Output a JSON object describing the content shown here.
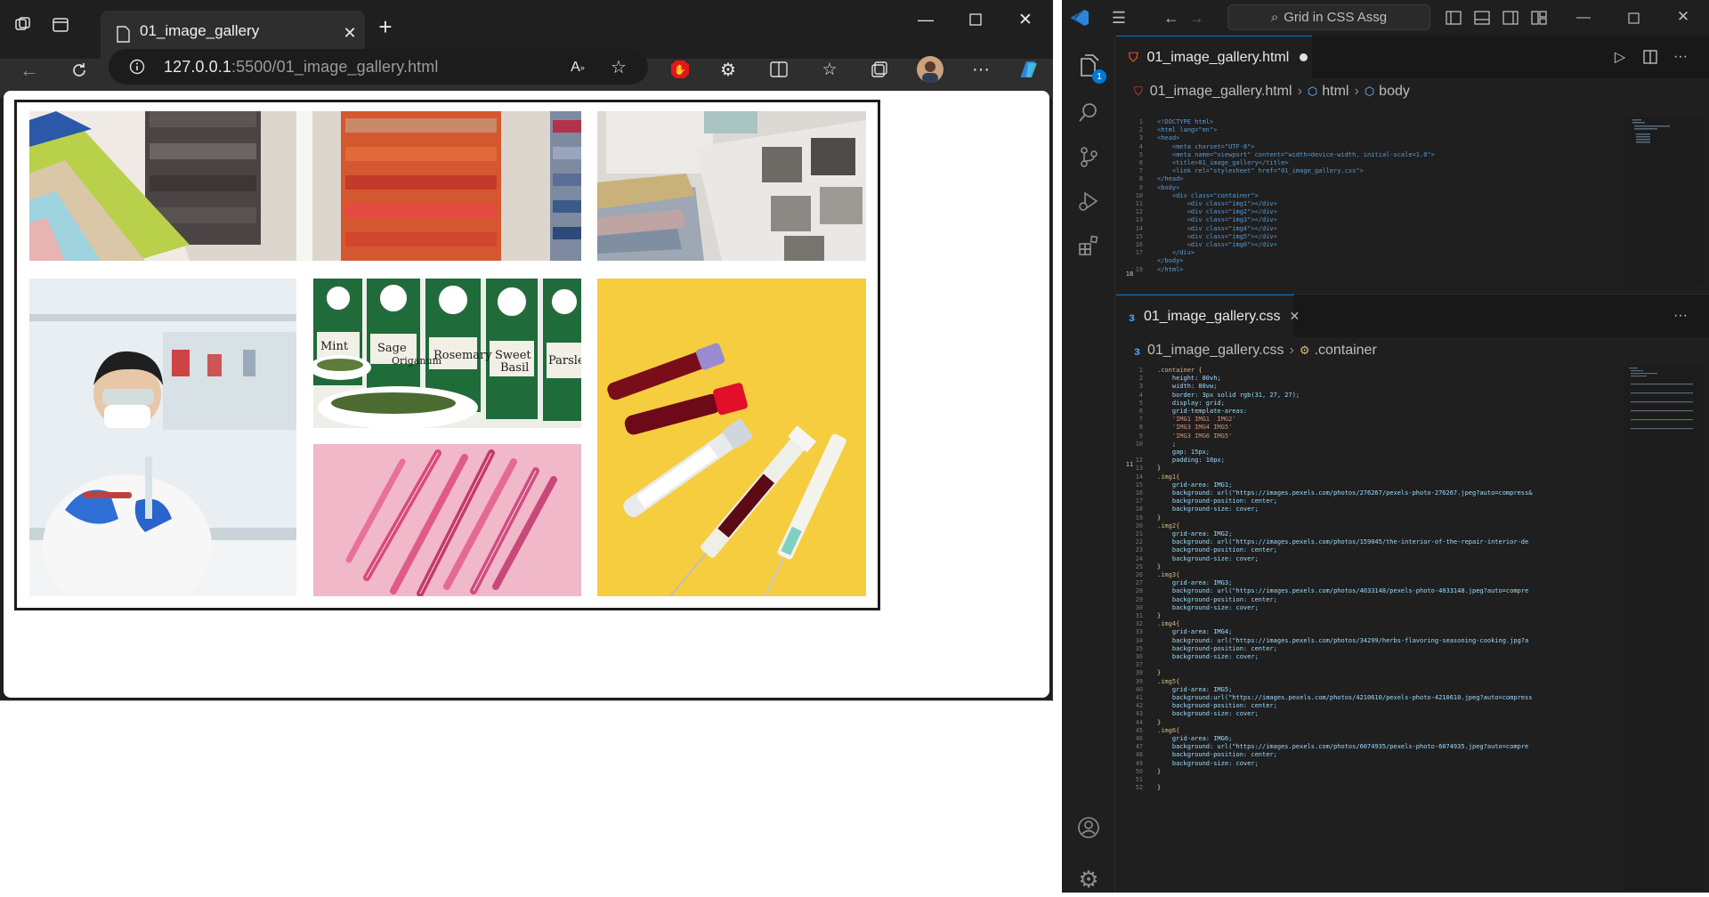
{
  "browser": {
    "tab_title": "01_image_gallery",
    "url_host": "127.0.0.1",
    "url_rest": ":5500/01_image_gallery.html",
    "accent": "#2b86d9"
  },
  "gallery": {
    "border_color": "#1f1b1b",
    "images": [
      {
        "name": "fabric-swatches"
      },
      {
        "name": "material-samples"
      },
      {
        "name": "lab-scientist"
      },
      {
        "name": "herb-jars"
      },
      {
        "name": "pink-syringes"
      },
      {
        "name": "blood-tubes"
      }
    ]
  },
  "vscode": {
    "search_label": "Grid in CSS Assg",
    "explorer_badge": "1",
    "html_tab": "01_image_gallery.html",
    "css_tab": "01_image_gallery.css",
    "html_crumbs": [
      "01_image_gallery.html",
      "html",
      "body"
    ],
    "css_crumbs": [
      "01_image_gallery.css",
      ".container"
    ],
    "html_code": [
      "<!DOCTYPE html>",
      "<html lang=\"en\">",
      "<head>",
      "    <meta charset=\"UTF-8\">",
      "    <meta name=\"viewport\" content=\"width=device-width, initial-scale=1.0\">",
      "    <title>01_image_gallery</title>",
      "    <link rel=\"stylesheet\" href=\"01_image_gallery.css\">",
      "</head>",
      "<body>",
      "    <div class=\"container\">",
      "        <div class=\"img1\"></div>",
      "        <div class=\"img2\"></div>",
      "        <div class=\"img3\"></div>",
      "        <div class=\"img4\"></div>",
      "        <div class=\"img5\"></div>",
      "        <div class=\"img6\"></div>",
      "    </div>",
      "</body>",
      "</html>"
    ],
    "css_code": [
      ".container {",
      "    height: 80vh;",
      "    width: 80vw;",
      "    border: 3px solid rgb(31, 27, 27);",
      "    display: grid;",
      "    grid-template-areas:",
      "    'IMG1 IMG1  IMG2'",
      "    'IMG3 IMG4 IMG5'",
      "    'IMG3 IMG6 IMG5'",
      "    ;",
      "    gap: 15px;",
      "    padding: 10px;",
      "}",
      ".img1{",
      "    grid-area: IMG1;",
      "    background: url(\"https://images.pexels.com/photos/276267/pexels-photo-276267.jpeg?auto=compress&",
      "    background-position: center;",
      "    background-size: cover;",
      "}",
      ".img2{",
      "    grid-area: IMG2;",
      "    background: url(\"https://images.pexels.com/photos/159045/the-interior-of-the-repair-interior-de",
      "    background-position: center;",
      "    background-size: cover;",
      "}",
      ".img3{",
      "    grid-area: IMG3;",
      "    background: url(\"https://images.pexels.com/photos/4033148/pexels-photo-4033148.jpeg?auto=compre",
      "    background-position: center;",
      "    background-size: cover;",
      "}",
      ".img4{",
      "    grid-area: IMG4;",
      "    background: url(\"https://images.pexels.com/photos/34299/herbs-flavoring-seasoning-cooking.jpg?a",
      "    background-position: center;",
      "    background-size: cover;",
      "",
      "}",
      ".img5{",
      "    grid-area: IMG5;",
      "    background:url(\"https://images.pexels.com/photos/4210610/pexels-photo-4210610.jpeg?auto=compress",
      "    background-position: center;",
      "    background-size: cover;",
      "}",
      ".img6{",
      "    grid-area: IMG6;",
      "    background: url(\"https://images.pexels.com/photos/6074935/pexels-photo-6074935.jpeg?auto=compre",
      "    background-position: center;",
      "    background-size: cover;",
      "}",
      "",
      "}"
    ]
  }
}
